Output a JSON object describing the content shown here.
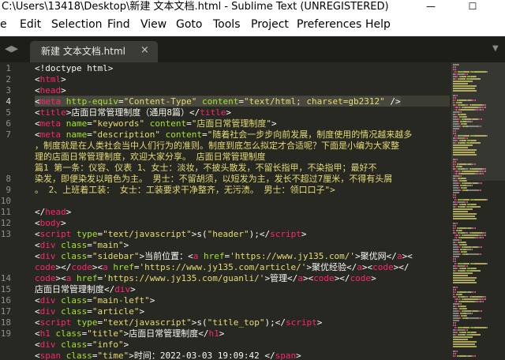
{
  "window": {
    "title": "C:\\Users\\13418\\Desktop\\新建 文本文档.html - Sublime Text (UNREGISTERED)",
    "minimize_glyph": "—",
    "maximize_glyph": "☐"
  },
  "menu": [
    "e",
    "Edit",
    "Selection",
    "Find",
    "View",
    "Goto",
    "Tools",
    "Project",
    "Preferences",
    "Help"
  ],
  "tabs": {
    "left_arrow": "◀▶",
    "active": {
      "label": "新建 文本文档.html",
      "close": "×"
    },
    "dropdown": "▼"
  },
  "editor": {
    "current_line": 4,
    "line_numbers": [
      "1",
      "2",
      "3",
      "4",
      "5",
      "6",
      "7",
      "",
      "",
      "",
      "8",
      "9",
      "10",
      "11",
      "12",
      "13",
      "",
      "",
      "",
      "14",
      "15",
      "16",
      "17",
      "18",
      "19"
    ],
    "lines": [
      [
        {
          "t": "<!doctype html>",
          "c": ""
        }
      ],
      [
        {
          "t": "<",
          "c": ""
        },
        {
          "t": "html",
          "c": "t"
        },
        {
          "t": ">",
          "c": ""
        }
      ],
      [
        {
          "t": "<",
          "c": ""
        },
        {
          "t": "head",
          "c": "t"
        },
        {
          "t": ">",
          "c": ""
        }
      ],
      [
        {
          "t": "    ",
          "c": ""
        },
        {
          "t": "<",
          "c": "hl"
        },
        {
          "t": "meta",
          "c": "t hl"
        },
        {
          "t": " ",
          "c": "hl"
        },
        {
          "t": "http-equiv",
          "c": "a hl"
        },
        {
          "t": "=",
          "c": "hl"
        },
        {
          "t": "\"Content-Type\"",
          "c": "s hl"
        },
        {
          "t": " ",
          "c": "hl"
        },
        {
          "t": "content",
          "c": "a hl"
        },
        {
          "t": "=",
          "c": "hl"
        },
        {
          "t": "\"text/html; charset=gb2312\"",
          "c": "s hl"
        },
        {
          "t": " />",
          "c": "hl"
        }
      ],
      [
        {
          "t": "    <",
          "c": ""
        },
        {
          "t": "title",
          "c": "t"
        },
        {
          "t": ">店面日常管理制度（通用8篇）</",
          "c": ""
        },
        {
          "t": "title",
          "c": "t"
        },
        {
          "t": ">",
          "c": ""
        }
      ],
      [
        {
          "t": "        <",
          "c": ""
        },
        {
          "t": "meta",
          "c": "t"
        },
        {
          "t": " ",
          "c": ""
        },
        {
          "t": "name",
          "c": "a"
        },
        {
          "t": "=",
          "c": ""
        },
        {
          "t": "\"keywords\"",
          "c": "s"
        },
        {
          "t": " ",
          "c": ""
        },
        {
          "t": "content",
          "c": "a"
        },
        {
          "t": "=",
          "c": ""
        },
        {
          "t": "\"店面日常管理制度\"",
          "c": "s"
        },
        {
          "t": ">",
          "c": ""
        }
      ],
      [
        {
          "t": "    <",
          "c": ""
        },
        {
          "t": "meta",
          "c": "t"
        },
        {
          "t": " ",
          "c": ""
        },
        {
          "t": "name",
          "c": "a"
        },
        {
          "t": "=",
          "c": ""
        },
        {
          "t": "\"description\"",
          "c": "s"
        },
        {
          "t": " ",
          "c": ""
        },
        {
          "t": "content",
          "c": "a"
        },
        {
          "t": "=",
          "c": ""
        },
        {
          "t": "\"随着社会一步步向前发展，制度使用的情况越来越多",
          "c": "s"
        }
      ],
      [
        {
          "t": "    ，制度就是在人类社会当中人们行为的准则。制度到底怎么拟定才合适呢？下面是小编为大家整",
          "c": "s"
        }
      ],
      [
        {
          "t": "    理的店面日常管理制度，欢迎大家分享。     店面日常管理制度",
          "c": "s"
        }
      ],
      [
        {
          "t": "    篇1     第一条：仪容、仪表      1、女士：淡妆，不披头散发，不留长指甲，不染指甲；最好不",
          "c": "s"
        }
      ],
      [
        {
          "t": "    染发，即便染发以暗色为主。      男士：不留胡须，以短发为主，发长不超过7厘米，不得有头屑",
          "c": "s"
        }
      ],
      [
        {
          "t": "    。     2、上班着工装：      女士：工装要求干净整齐，无污渍。     男士：领口口子\">",
          "c": "s"
        }
      ],
      [
        {
          "t": "",
          "c": ""
        }
      ],
      [
        {
          "t": "    </",
          "c": ""
        },
        {
          "t": "head",
          "c": "t"
        },
        {
          "t": ">",
          "c": ""
        }
      ],
      [
        {
          "t": "<",
          "c": ""
        },
        {
          "t": "body",
          "c": "t"
        },
        {
          "t": ">",
          "c": ""
        }
      ],
      [
        {
          "t": "<",
          "c": ""
        },
        {
          "t": "script",
          "c": "t"
        },
        {
          "t": " ",
          "c": ""
        },
        {
          "t": "type",
          "c": "a"
        },
        {
          "t": "=",
          "c": ""
        },
        {
          "t": "\"text/javascript\"",
          "c": "s"
        },
        {
          "t": ">s(",
          "c": ""
        },
        {
          "t": "\"header\"",
          "c": "s"
        },
        {
          "t": ");</",
          "c": ""
        },
        {
          "t": "script",
          "c": "t"
        },
        {
          "t": ">",
          "c": ""
        }
      ],
      [
        {
          "t": "<",
          "c": ""
        },
        {
          "t": "div",
          "c": "t"
        },
        {
          "t": " ",
          "c": ""
        },
        {
          "t": "class",
          "c": "a"
        },
        {
          "t": "=",
          "c": ""
        },
        {
          "t": "\"main\"",
          "c": "s"
        },
        {
          "t": ">",
          "c": ""
        }
      ],
      [
        {
          "t": "    <",
          "c": ""
        },
        {
          "t": "div",
          "c": "t"
        },
        {
          "t": " ",
          "c": ""
        },
        {
          "t": "class",
          "c": "a"
        },
        {
          "t": "=",
          "c": ""
        },
        {
          "t": "\"sidebar\"",
          "c": "s"
        },
        {
          "t": ">当前位置：<",
          "c": ""
        },
        {
          "t": "a",
          "c": "t"
        },
        {
          "t": " ",
          "c": ""
        },
        {
          "t": "href",
          "c": "a"
        },
        {
          "t": "=",
          "c": ""
        },
        {
          "t": "'https://www.jy135.com/'",
          "c": "s"
        },
        {
          "t": ">聚优网</",
          "c": ""
        },
        {
          "t": "a",
          "c": "t"
        },
        {
          "t": "><",
          "c": ""
        }
      ],
      [
        {
          "t": "    ",
          "c": ""
        },
        {
          "t": "code",
          "c": "t"
        },
        {
          "t": "></",
          "c": ""
        },
        {
          "t": "code",
          "c": "t"
        },
        {
          "t": "><",
          "c": ""
        },
        {
          "t": "a",
          "c": "t"
        },
        {
          "t": " ",
          "c": ""
        },
        {
          "t": "href",
          "c": "a"
        },
        {
          "t": "=",
          "c": ""
        },
        {
          "t": "'https://www.jy135.com/article/'",
          "c": "s"
        },
        {
          "t": ">聚优经验</",
          "c": ""
        },
        {
          "t": "a",
          "c": "t"
        },
        {
          "t": "><",
          "c": ""
        },
        {
          "t": "code",
          "c": "t"
        },
        {
          "t": "></",
          "c": ""
        }
      ],
      [
        {
          "t": "    ",
          "c": ""
        },
        {
          "t": "code",
          "c": "t"
        },
        {
          "t": "><",
          "c": ""
        },
        {
          "t": "a",
          "c": "t"
        },
        {
          "t": " ",
          "c": ""
        },
        {
          "t": "href",
          "c": "a"
        },
        {
          "t": "=",
          "c": ""
        },
        {
          "t": "'https://www.jy135.com/guanli/'",
          "c": "s"
        },
        {
          "t": ">管理</",
          "c": ""
        },
        {
          "t": "a",
          "c": "t"
        },
        {
          "t": "><",
          "c": ""
        },
        {
          "t": "code",
          "c": "t"
        },
        {
          "t": "></",
          "c": ""
        },
        {
          "t": "code",
          "c": "t"
        },
        {
          "t": ">",
          "c": ""
        }
      ],
      [
        {
          "t": "    店面日常管理制度</",
          "c": ""
        },
        {
          "t": "div",
          "c": "t"
        },
        {
          "t": ">",
          "c": ""
        }
      ],
      [
        {
          "t": "    <",
          "c": ""
        },
        {
          "t": "div",
          "c": "t"
        },
        {
          "t": " ",
          "c": ""
        },
        {
          "t": "class",
          "c": "a"
        },
        {
          "t": "=",
          "c": ""
        },
        {
          "t": "\"main-left\"",
          "c": "s"
        },
        {
          "t": ">",
          "c": ""
        }
      ],
      [
        {
          "t": "        <",
          "c": ""
        },
        {
          "t": "div",
          "c": "t"
        },
        {
          "t": " ",
          "c": ""
        },
        {
          "t": "class",
          "c": "a"
        },
        {
          "t": "=",
          "c": ""
        },
        {
          "t": "\"article\"",
          "c": "s"
        },
        {
          "t": ">",
          "c": ""
        }
      ],
      [
        {
          "t": "            <",
          "c": ""
        },
        {
          "t": "script",
          "c": "t"
        },
        {
          "t": " ",
          "c": ""
        },
        {
          "t": "type",
          "c": "a"
        },
        {
          "t": "=",
          "c": ""
        },
        {
          "t": "\"text/javascript\"",
          "c": "s"
        },
        {
          "t": ">s(",
          "c": ""
        },
        {
          "t": "\"title_top\"",
          "c": "s"
        },
        {
          "t": ");</",
          "c": ""
        },
        {
          "t": "script",
          "c": "t"
        },
        {
          "t": ">",
          "c": ""
        }
      ],
      [
        {
          "t": "            <",
          "c": ""
        },
        {
          "t": "h1",
          "c": "t"
        },
        {
          "t": " ",
          "c": ""
        },
        {
          "t": "class",
          "c": "a"
        },
        {
          "t": "=",
          "c": ""
        },
        {
          "t": "\"title\"",
          "c": "s"
        },
        {
          "t": ">店面日常管理制度</",
          "c": ""
        },
        {
          "t": "h1",
          "c": "t"
        },
        {
          "t": ">",
          "c": ""
        }
      ],
      [
        {
          "t": "            <",
          "c": ""
        },
        {
          "t": "div",
          "c": "t"
        },
        {
          "t": " ",
          "c": ""
        },
        {
          "t": "class",
          "c": "a"
        },
        {
          "t": "=",
          "c": ""
        },
        {
          "t": "\"info\"",
          "c": "s"
        },
        {
          "t": ">",
          "c": ""
        }
      ],
      [
        {
          "t": "                <",
          "c": ""
        },
        {
          "t": "span",
          "c": "t"
        },
        {
          "t": " ",
          "c": ""
        },
        {
          "t": "class",
          "c": "a"
        },
        {
          "t": "=",
          "c": ""
        },
        {
          "t": "\"time\"",
          "c": "s"
        },
        {
          "t": ">时间：2022-03-03 19:09:42 </",
          "c": ""
        },
        {
          "t": "span",
          "c": "t"
        },
        {
          "t": ">",
          "c": ""
        }
      ]
    ]
  }
}
